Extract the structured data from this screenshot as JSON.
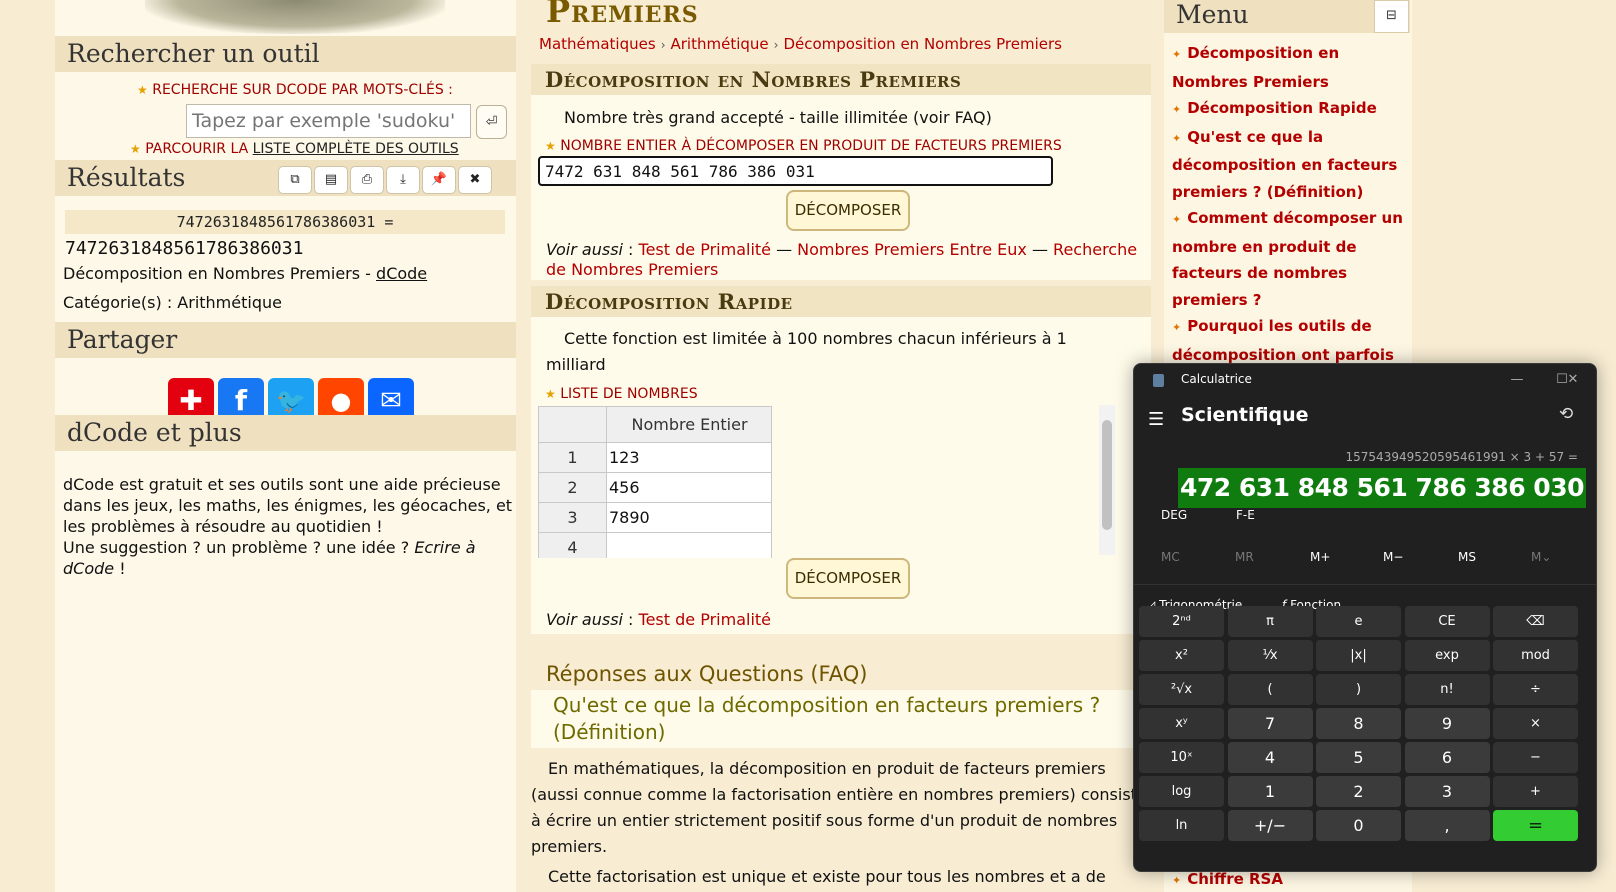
{
  "left": {
    "search_title": "Rechercher un outil",
    "keyword_label": "RECHERCHE SUR DCODE PAR MOTS-CLÉS :",
    "search_placeholder": "Tapez par exemple 'sudoku'",
    "search_go": "⏎",
    "browse_prefix": "PARCOURIR LA ",
    "browse_link": "LISTE COMPLÈTE DES OUTILS",
    "results_title": "Résultats",
    "result_expr": "7472631848561786386031 =",
    "result_value": "7472631848561786386031",
    "tool_name": "Décomposition en Nombres Premiers - ",
    "tool_site": "dCode",
    "category": "Catégorie(s) : Arithmétique",
    "share_title": "Partager",
    "more_title": "dCode et plus",
    "about_1": "dCode est gratuit et ses outils sont une aide précieuse dans les jeux, les maths, les énigmes, les géocaches, et les problèmes à résoudre au quotidien !",
    "about_2": "Une suggestion ? un problème ? une idée ? ",
    "about_link": "Ecrire à dCode",
    "about_end": " !"
  },
  "main": {
    "title": "Premiers",
    "breadcrumbs": [
      "Mathématiques",
      "Arithmétique",
      "Décomposition en Nombres Premiers"
    ],
    "section1_title": "Décomposition en Nombres Premiers",
    "section1_note": "Nombre très grand accepté - taille illimitée (voir FAQ)",
    "number_label": "NOMBRE ENTIER À DÉCOMPOSER EN PRODUIT DE FACTEURS PREMIERS",
    "number_value": "7472 631 848 561 786 386 031",
    "decompose_label": "DÉCOMPOSER",
    "see_also": "Voir aussi",
    "see_links_1": [
      "Test de Primalité",
      "Nombres Premiers Entre Eux",
      "Recherche de Nombres Premiers"
    ],
    "section2_title": "Décomposition Rapide",
    "section2_note": "Cette fonction est limitée à 100 nombres chacun inférieurs à 1 milliard",
    "list_label": "LISTE DE NOMBRES",
    "table_header": "Nombre Entier",
    "table_rows": [
      {
        "idx": "1",
        "val": "123"
      },
      {
        "idx": "2",
        "val": "456"
      },
      {
        "idx": "3",
        "val": "7890"
      },
      {
        "idx": "4",
        "val": ""
      }
    ],
    "see_links_2": [
      "Test de Primalité"
    ],
    "faq_title": "Réponses aux Questions (FAQ)",
    "faq_q1": "Qu'est ce que la décomposition en facteurs premiers ? (Définition)",
    "faq_p1": "En mathématiques, la décomposition en produit de facteurs premiers (aussi connue comme la factorisation entière en nombres premiers) consiste à écrire un entier strictement positif sous forme d'un produit de nombres premiers.",
    "faq_p2": "Cette factorisation est unique et existe pour tous les nombres et a de"
  },
  "menu": {
    "title": "Menu",
    "toggle": "⊟",
    "items": [
      "Décomposition en Nombres Premiers",
      "Décomposition Rapide",
      "Qu'est ce que la décomposition en facteurs premiers ? (Définition)",
      "Comment décomposer un nombre en produit de facteurs de nombres premiers ?",
      "Pourquoi les outils de décomposition ont parfois des limites ?"
    ],
    "last_item": "Chiffre RSA"
  },
  "calculator": {
    "app_title": "Calculatrice",
    "mode": "Scientifique",
    "expression": "1575439495205954619​91 × 3 + 57 =",
    "display": "472 631 848 561 786 386 030",
    "angle": "DEG",
    "fe": "F-E",
    "memory": [
      "MC",
      "MR",
      "M+",
      "M−",
      "MS",
      "M⌄"
    ],
    "trig": "Trigonométrie",
    "func": "Fonction",
    "rows": [
      [
        "2ⁿᵈ",
        "π",
        "e",
        "CE",
        "⌫"
      ],
      [
        "x²",
        "¹⁄x",
        "|x|",
        "exp",
        "mod"
      ],
      [
        "²√x",
        "(",
        ")",
        "n!",
        "÷"
      ],
      [
        "xʸ",
        "7",
        "8",
        "9",
        "×"
      ],
      [
        "10ˣ",
        "4",
        "5",
        "6",
        "−"
      ],
      [
        "log",
        "1",
        "2",
        "3",
        "+"
      ],
      [
        "ln",
        "+/−",
        "0",
        ",",
        "="
      ]
    ]
  }
}
